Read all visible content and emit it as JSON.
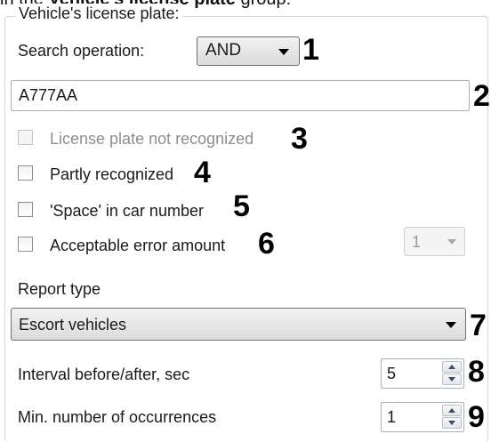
{
  "top_caption": {
    "prefix": "in the ",
    "bold": "Vehicle's license plate",
    "suffix": " group:"
  },
  "group": {
    "legend": "Vehicle's license plate:"
  },
  "search_operation": {
    "label": "Search operation:",
    "value": "AND",
    "marker": "1"
  },
  "plate_input": {
    "value": "A777AA",
    "marker": "2"
  },
  "not_recognized": {
    "label": "License plate not recognized",
    "checked": false,
    "disabled": true,
    "marker": "3"
  },
  "partly_recognized": {
    "label": "Partly recognized",
    "checked": false,
    "marker": "4"
  },
  "space_in_number": {
    "label": "'Space' in car number",
    "checked": false,
    "marker": "5"
  },
  "acceptable_error": {
    "label": "Acceptable error amount",
    "checked": false,
    "value": "1",
    "marker": "6"
  },
  "report_type": {
    "label": "Report type",
    "value": "Escort vehicles",
    "marker": "7"
  },
  "interval": {
    "label": "Interval before/after, sec",
    "value": "5",
    "marker": "8"
  },
  "min_occurrences": {
    "label": "Min. number of occurrences",
    "value": "1",
    "marker": "9"
  },
  "icons": [
    "dropdown-arrow-icon",
    "spin-up-icon",
    "spin-down-icon",
    "checkbox-icon"
  ]
}
